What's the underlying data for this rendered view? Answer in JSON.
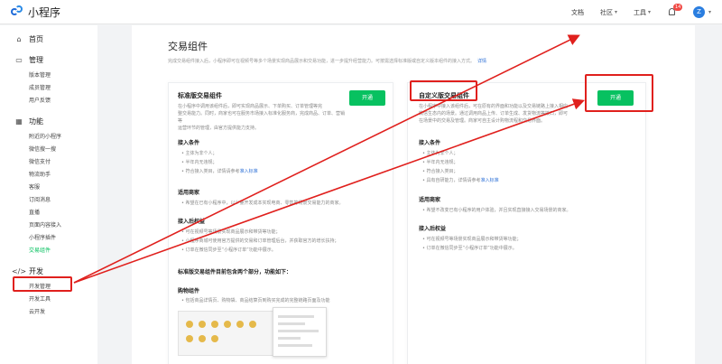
{
  "app": {
    "logo_text": "小程序"
  },
  "topnav": {
    "docs": "文档",
    "community": "社区",
    "tools": "工具",
    "notice_count": "14",
    "avatar_letter": "Z"
  },
  "sidebar": {
    "home": "首页",
    "manage": "管理",
    "manage_items": [
      "版本管理",
      "成员管理",
      "用户反馈"
    ],
    "features": "功能",
    "feature_items": [
      "附近的小程序",
      "微信搜一搜",
      "微信支付",
      "物流助手",
      "客服",
      "订阅消息",
      "直播",
      "页面内容接入",
      "小程序插件",
      "交易组件"
    ],
    "develop": "开发",
    "develop_items": [
      "开发管理",
      "开发工具",
      "云开发"
    ]
  },
  "main": {
    "title": "交易组件",
    "description": "完成交易组件接入后，小程序即可在视频号等多个场景实现商品展示和交易功能，进一步提升经营能力。可按需选择标准版或自定义版本组件的接入方式。",
    "description_link": "详情"
  },
  "card_left": {
    "title": "标准版交易组件",
    "button": "开通",
    "intro": [
      "在小程序中调用该组件后，即可实现商品展示、下单购买、订单管理等完",
      "整交易能力。同时，商家也可在服务市场接入标准化服务商，完成商品、订单、营销等",
      "运营环节的管理，由官方提供能力支持。"
    ],
    "sec1": "接入条件",
    "sec1_items": [
      "主体为非个人；",
      "半年内无违规；",
      "符合接入类目，详情请参考"
    ],
    "sec1_link": "准入标准",
    "sec2": "适用商家",
    "sec2_items": [
      "希望在已有小程序中，以少量开发成本实现电商、零售等场景交易能力的商家。"
    ],
    "sec3": "接入后权益",
    "sec3_items": [
      "可在视频号等场景实现商品展示和带货等功能；",
      "小程序商城可使用官方提供的交易和订单管理后台，并获取官方的增长扶持；",
      "订单在微信同步至“小程序订单”功能中展示。"
    ],
    "sec4": "标准版交易组件目前包含两个部分，功能如下：",
    "sec5": "购物组件",
    "sec5_items": [
      "包括商品详情页、购物袋、商品结算页到购买完成的完整链路页面及功能"
    ]
  },
  "card_right": {
    "title": "自定义版交易组件",
    "button": "开通",
    "intro": [
      "在小程序中接入该组件后，可在原有的界面和功能以及交易链路上接入相应",
      "微信生态内的场景。通过调用商品上传、订单生成、发货物流等接口，即可",
      "在场景中的交易及管理。商家可自主设计购物流程和交易界面。"
    ],
    "sec1": "接入条件",
    "sec1_items": [
      "主体为非个人；",
      "半年内无违规；",
      "符合接入类目；",
      "具有自研能力，详情请参考"
    ],
    "sec1_link": "准入标准",
    "sec2": "适用商家",
    "sec2_items": [
      "希望不改变已有小程序的用户体验，并且实现直接接入交易场景的商家。"
    ],
    "sec3": "接入后权益",
    "sec3_items": [
      "可在视频号等场景实现商品展示和带货等功能；",
      "订单在微信同步至“小程序订单”功能中展示。"
    ]
  },
  "colors": {
    "accent_green": "#07c160",
    "annotation_red": "#e0201d",
    "link_blue": "#2c6fd6"
  }
}
